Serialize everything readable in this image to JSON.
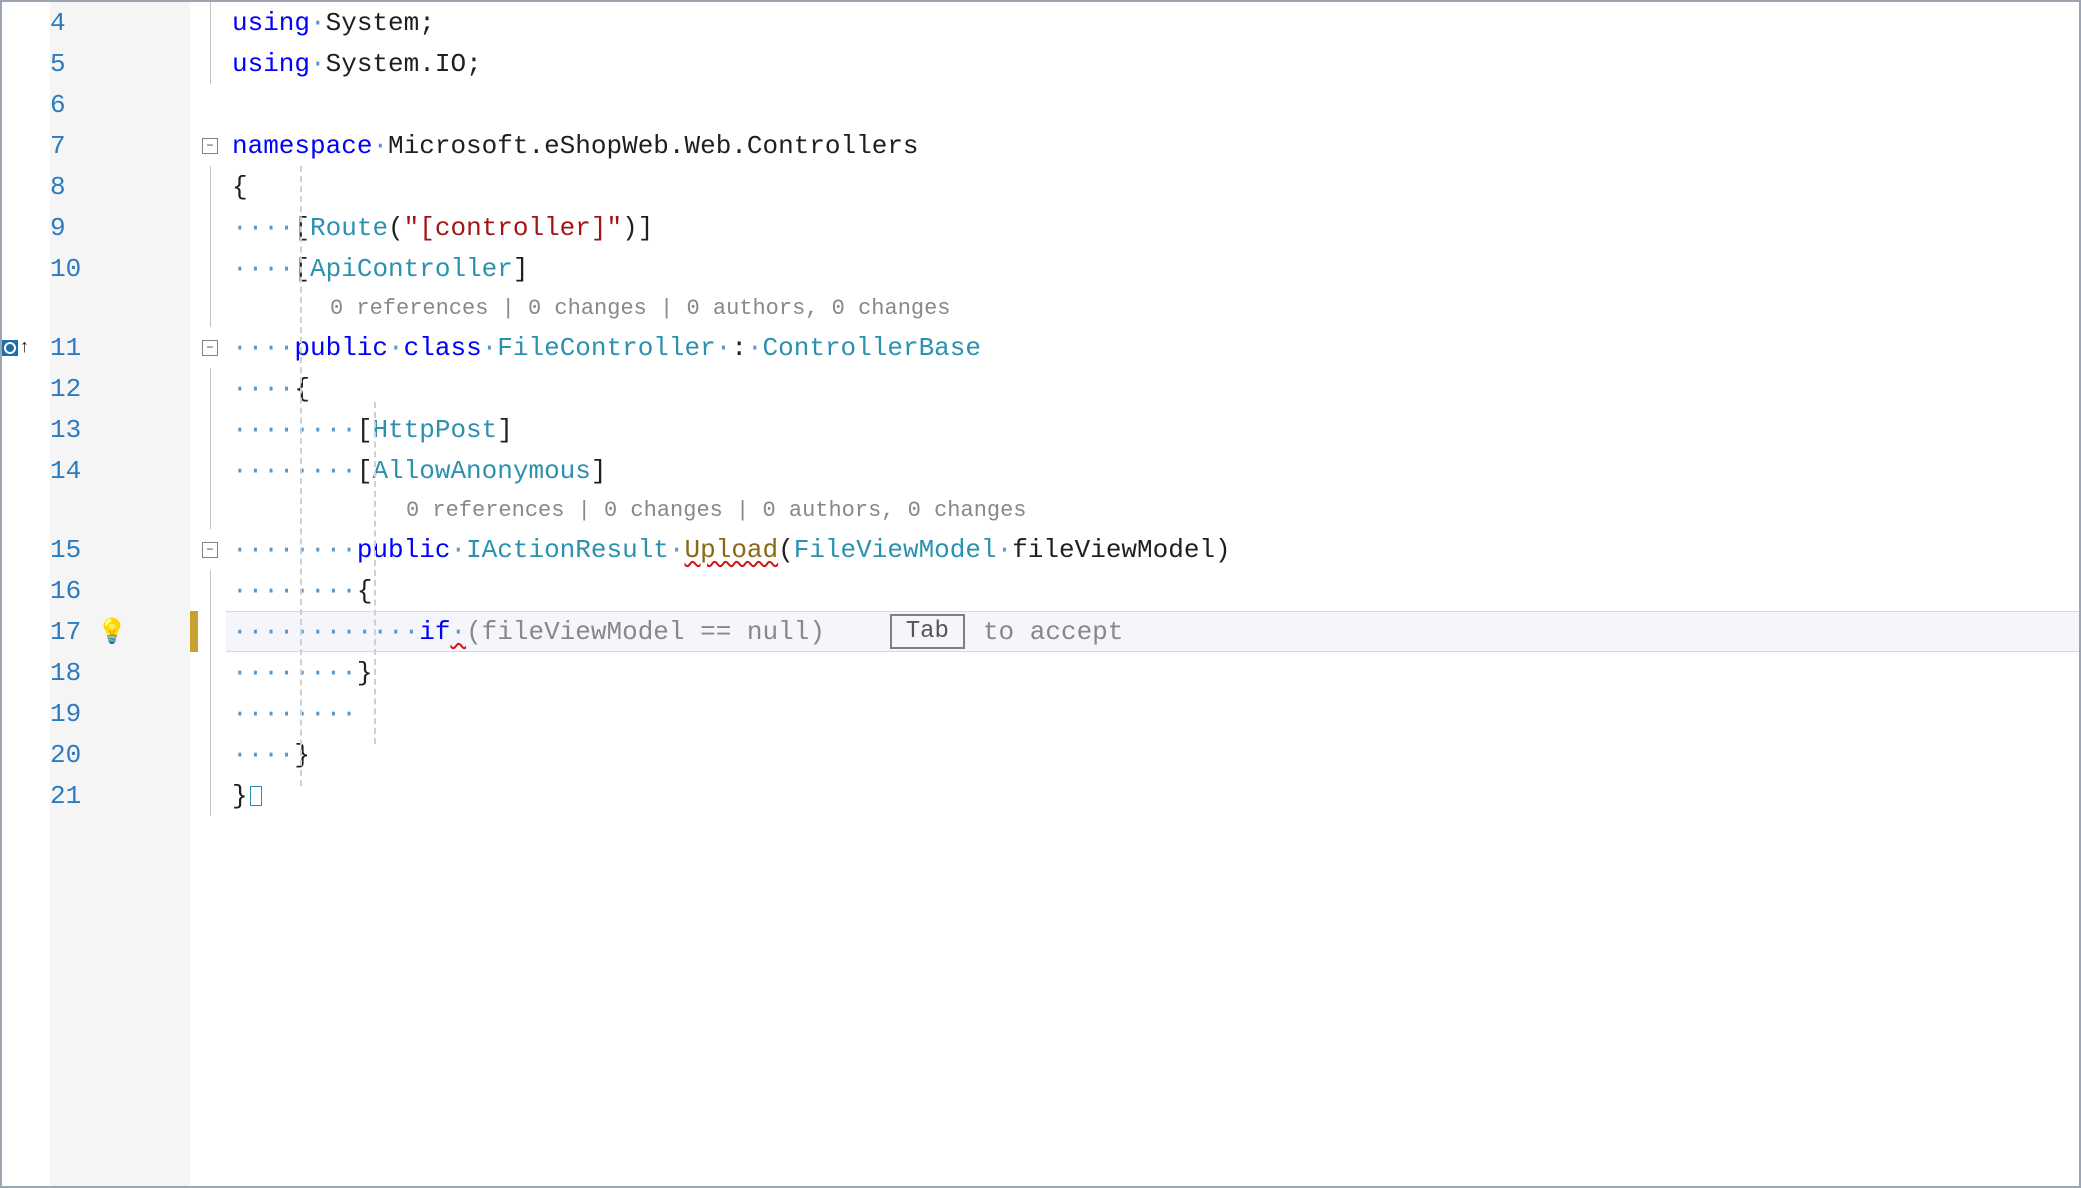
{
  "lines": {
    "4": "4",
    "5": "5",
    "6": "6",
    "7": "7",
    "8": "8",
    "9": "9",
    "10": "10",
    "11": "11",
    "12": "12",
    "13": "13",
    "14": "14",
    "15": "15",
    "16": "16",
    "17": "17",
    "18": "18",
    "19": "19",
    "20": "20",
    "21": "21"
  },
  "code": {
    "l4_using": "using",
    "l4_ns": "System",
    "l5_using": "using",
    "l5_ns": "System.IO",
    "l7_kw": "namespace",
    "l7_ns": "Microsoft.eShopWeb.Web.Controllers",
    "l8_brace": "{",
    "l9_attr": "Route",
    "l9_str": "\"[controller]\"",
    "l10_attr": "ApiController",
    "lens1": "0 references | 0 changes | 0 authors, 0 changes",
    "l11_public": "public",
    "l11_class": "class",
    "l11_name": "FileController",
    "l11_base": "ControllerBase",
    "l12_brace": "{",
    "l13_attr": "HttpPost",
    "l14_attr": "AllowAnonymous",
    "lens2": "0 references | 0 changes | 0 authors, 0 changes",
    "l15_public": "public",
    "l15_type": "IActionResult",
    "l15_method": "Upload",
    "l15_ptype": "FileViewModel",
    "l15_pname": "fileViewModel",
    "l16_brace": "{",
    "l17_if": "if",
    "l17_ghost": "(fileViewModel == null)",
    "l17_hint_key": "Tab",
    "l17_hint_text": "to accept",
    "l18_brace": "}",
    "l20_brace": "}",
    "l21_brace": "}"
  },
  "dots": {
    "d4": "····",
    "d8": "········",
    "d12": "············"
  }
}
